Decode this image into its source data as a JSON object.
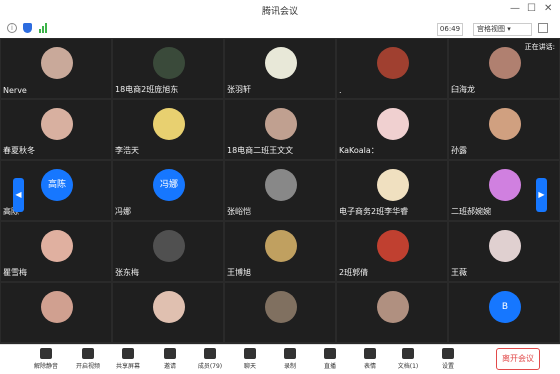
{
  "window": {
    "title": "腾讯会议",
    "timer": "06:49",
    "view_mode": "宫格视图"
  },
  "speaking_label": "正在讲话:",
  "participants": [
    {
      "name": "Nerve",
      "color": "#c9a99a"
    },
    {
      "name": "18电商2班庞旭东",
      "color": "#3a4a3a"
    },
    {
      "name": "张羽轩",
      "color": "#e8e8d8"
    },
    {
      "name": ".",
      "color": "#a04030"
    },
    {
      "name": "臼海龙",
      "color": "#b08070"
    },
    {
      "name": "春夏秋冬",
      "color": "#d8b0a0"
    },
    {
      "name": "李浩天",
      "color": "#e8d070"
    },
    {
      "name": "18电商二班王文文",
      "color": "#c0a090"
    },
    {
      "name": "KaKoala：",
      "color": "#f0d0d0"
    },
    {
      "name": "孙露",
      "color": "#d0a080"
    },
    {
      "name": "高陈",
      "initials": "高陈",
      "color": "#1677ff"
    },
    {
      "name": "冯娜",
      "initials": "冯娜",
      "color": "#1677ff"
    },
    {
      "name": "张峪恺",
      "color": "#888888"
    },
    {
      "name": "电子商务2班李华睿",
      "color": "#f0e0c0"
    },
    {
      "name": "二班郝婉婉",
      "color": "#d080e0"
    },
    {
      "name": "瞿雪梅",
      "color": "#e0b0a0"
    },
    {
      "name": "张东梅",
      "color": "#505050"
    },
    {
      "name": "王博旭",
      "color": "#c0a060"
    },
    {
      "name": "2班郭倩",
      "color": "#c04030"
    },
    {
      "name": "王薇",
      "color": "#e0d0d0"
    },
    {
      "name": "",
      "color": "#d0a090"
    },
    {
      "name": "",
      "color": "#e0c0b0"
    },
    {
      "name": "",
      "color": "#807060"
    },
    {
      "name": "",
      "color": "#b09080"
    },
    {
      "name": "",
      "initials": "B",
      "color": "#1677ff"
    }
  ],
  "toolbar": {
    "mute": "解除静音",
    "video": "开启视频",
    "share": "共享屏幕",
    "invite": "邀请",
    "members": "成员(79)",
    "chat": "聊天",
    "record": "录制",
    "live": "直播",
    "emoji": "表情",
    "docs": "文档(1)",
    "settings": "设置",
    "leave": "离开会议"
  }
}
